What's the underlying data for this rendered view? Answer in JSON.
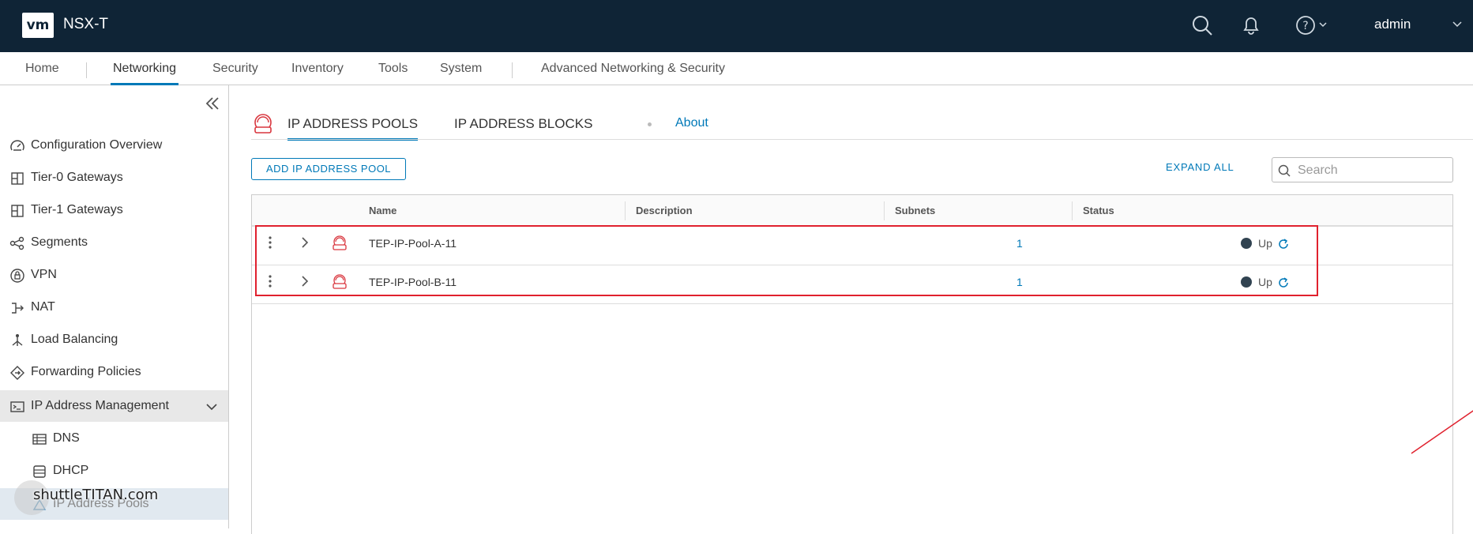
{
  "header": {
    "logo": "vm",
    "title": "NSX-T",
    "user": "admin"
  },
  "topnav": {
    "items": [
      "Home",
      "Networking",
      "Security",
      "Inventory",
      "Tools",
      "System",
      "Advanced Networking & Security"
    ],
    "active": "Networking"
  },
  "sidebar": {
    "items": [
      {
        "label": "Configuration Overview",
        "icon": "dashboard-icon"
      },
      {
        "label": "Tier-0 Gateways",
        "icon": "gateway-icon"
      },
      {
        "label": "Tier-1 Gateways",
        "icon": "gateway-icon"
      },
      {
        "label": "Segments",
        "icon": "segments-icon"
      },
      {
        "label": "VPN",
        "icon": "vpn-icon"
      },
      {
        "label": "NAT",
        "icon": "nat-icon"
      },
      {
        "label": "Load Balancing",
        "icon": "load-balancing-icon"
      },
      {
        "label": "Forwarding Policies",
        "icon": "forwarding-icon"
      },
      {
        "label": "IP Address Management",
        "icon": "ip-management-icon"
      },
      {
        "label": "DNS",
        "icon": "dns-icon"
      },
      {
        "label": "DHCP",
        "icon": "dhcp-icon"
      },
      {
        "label": "IP Address Pools",
        "icon": "ip-pool-icon"
      }
    ],
    "watermark": "shuttleTITAN.com"
  },
  "main": {
    "tabs": [
      "IP ADDRESS POOLS",
      "IP ADDRESS BLOCKS"
    ],
    "about": "About",
    "add_button": "ADD IP ADDRESS POOL",
    "expand_all": "EXPAND ALL",
    "search_placeholder": "Search",
    "columns": [
      "Name",
      "Description",
      "Subnets",
      "Status"
    ],
    "rows": [
      {
        "name": "TEP-IP-Pool-A-11",
        "description": "",
        "subnets": "1",
        "status": "Up"
      },
      {
        "name": "TEP-IP-Pool-B-11",
        "description": "",
        "subnets": "1",
        "status": "Up"
      }
    ]
  },
  "colors": {
    "header_bg": "#0f2436",
    "accent": "#0079b8",
    "highlight": "#e0212e",
    "status_up": "#314351"
  }
}
